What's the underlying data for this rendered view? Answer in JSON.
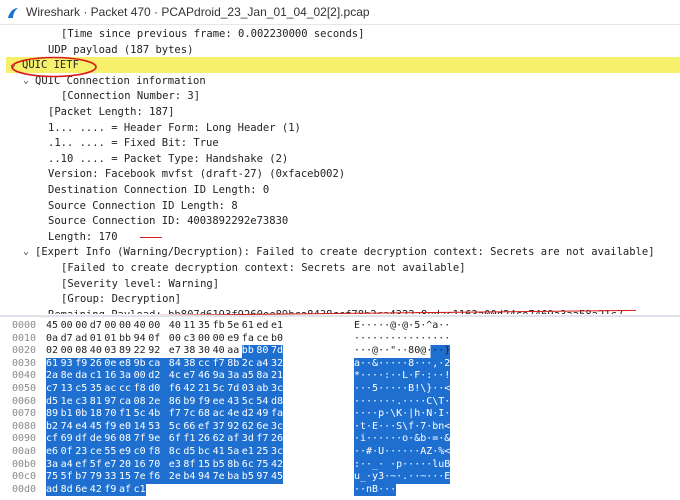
{
  "window": {
    "title": "Wireshark · Packet 470 · PCAPdroid_23_Jan_01_04_02[2].pcap"
  },
  "tree": [
    {
      "indent": 3,
      "chev": "",
      "text": "[Time since previous frame: 0.002230000 seconds]"
    },
    {
      "indent": 2,
      "chev": "",
      "text": "UDP payload (187 bytes)"
    },
    {
      "indent": 0,
      "chev": "v",
      "text": "QUIC IETF",
      "highlight": true
    },
    {
      "indent": 1,
      "chev": "v",
      "text": "QUIC Connection information"
    },
    {
      "indent": 3,
      "chev": "",
      "text": "[Connection Number: 3]"
    },
    {
      "indent": 2,
      "chev": "",
      "text": "[Packet Length: 187]"
    },
    {
      "indent": 2,
      "chev": "",
      "text": "1... .... = Header Form: Long Header (1)"
    },
    {
      "indent": 2,
      "chev": "",
      "text": ".1.. .... = Fixed Bit: True"
    },
    {
      "indent": 2,
      "chev": "",
      "text": "..10 .... = Packet Type: Handshake (2)"
    },
    {
      "indent": 2,
      "chev": "",
      "text": "Version: Facebook mvfst (draft-27) (0xfaceb002)"
    },
    {
      "indent": 2,
      "chev": "",
      "text": "Destination Connection ID Length: 0"
    },
    {
      "indent": 2,
      "chev": "",
      "text": "Source Connection ID Length: 8"
    },
    {
      "indent": 2,
      "chev": "",
      "text": "Source Connection ID: 4003892292e73830"
    },
    {
      "indent": 2,
      "chev": "",
      "text": "Length: 170"
    },
    {
      "indent": 1,
      "chev": "v",
      "text": "[Expert Info (Warning/Decryption): Failed to create decryption context: Secrets are not available]"
    },
    {
      "indent": 3,
      "chev": "",
      "text": "[Failed to create decryption context: Secrets are not available]"
    },
    {
      "indent": 3,
      "chev": "",
      "text": "[Severity level: Warning]"
    },
    {
      "indent": 3,
      "chev": "",
      "text": "[Group: Decryption]"
    },
    {
      "indent": 2,
      "chev": "",
      "text": "Remaining Payload: bb807d6193f9260ee89bca8438ccf78b2ca4322a8edac1163a00d24ce7469a3aa58a21c7…"
    }
  ],
  "hex_rows": [
    {
      "offset": "0000",
      "bytes": [
        "45",
        "00",
        "00",
        "d7",
        "00",
        "00",
        "40",
        "00",
        "40",
        "11",
        "35",
        "fb",
        "5e",
        "61",
        "ed",
        "e1"
      ],
      "ascii": "E·····@·@·5·^a··",
      "sel_from": 99
    },
    {
      "offset": "0010",
      "bytes": [
        "0a",
        "d7",
        "ad",
        "01",
        "01",
        "bb",
        "94",
        "0f",
        "00",
        "c3",
        "00",
        "00",
        "e9",
        "fa",
        "ce",
        "b0"
      ],
      "ascii": "················",
      "sel_from": 99
    },
    {
      "offset": "0020",
      "bytes": [
        "02",
        "00",
        "08",
        "40",
        "03",
        "89",
        "22",
        "92",
        "e7",
        "38",
        "30",
        "40",
        "aa",
        "bb",
        "80",
        "7d"
      ],
      "ascii": "···@··\"··80@···}",
      "sel_from": 13
    },
    {
      "offset": "0030",
      "bytes": [
        "61",
        "93",
        "f9",
        "26",
        "0e",
        "e8",
        "9b",
        "ca",
        "84",
        "38",
        "cc",
        "f7",
        "8b",
        "2c",
        "a4",
        "32"
      ],
      "ascii": "a··&·····8···,·2",
      "sel_from": 0
    },
    {
      "offset": "0040",
      "bytes": [
        "2a",
        "8e",
        "da",
        "c1",
        "16",
        "3a",
        "00",
        "d2",
        "4c",
        "e7",
        "46",
        "9a",
        "3a",
        "a5",
        "8a",
        "21"
      ],
      "ascii": "*····:··L·F·:··!",
      "sel_from": 0
    },
    {
      "offset": "0050",
      "bytes": [
        "c7",
        "13",
        "c5",
        "35",
        "ac",
        "cc",
        "f8",
        "d0",
        "f6",
        "42",
        "21",
        "5c",
        "7d",
        "03",
        "ab",
        "3c"
      ],
      "ascii": "···5·····B!\\}··<",
      "sel_from": 0
    },
    {
      "offset": "0060",
      "bytes": [
        "d5",
        "1e",
        "c3",
        "81",
        "97",
        "ca",
        "08",
        "2e",
        "86",
        "b9",
        "f9",
        "ee",
        "43",
        "5c",
        "54",
        "d8"
      ],
      "ascii": "·······.····C\\T·",
      "sel_from": 0
    },
    {
      "offset": "0070",
      "bytes": [
        "89",
        "b1",
        "0b",
        "18",
        "70",
        "f1",
        "5c",
        "4b",
        "f7",
        "7c",
        "68",
        "ac",
        "4e",
        "d2",
        "49",
        "fa"
      ],
      "ascii": "····p·\\K·|h·N·I·",
      "sel_from": 0
    },
    {
      "offset": "0080",
      "bytes": [
        "b2",
        "74",
        "e4",
        "45",
        "f9",
        "e0",
        "14",
        "53",
        "5c",
        "66",
        "ef",
        "37",
        "92",
        "62",
        "6e",
        "3c"
      ],
      "ascii": "·t·E···S\\f·7·bn<",
      "sel_from": 0
    },
    {
      "offset": "0090",
      "bytes": [
        "cf",
        "69",
        "df",
        "de",
        "96",
        "08",
        "7f",
        "9e",
        "6f",
        "f1",
        "26",
        "62",
        "af",
        "3d",
        "f7",
        "26"
      ],
      "ascii": "·i······o·&b·=·&",
      "sel_from": 0
    },
    {
      "offset": "00a0",
      "bytes": [
        "e6",
        "0f",
        "23",
        "ce",
        "55",
        "e9",
        "c0",
        "f8",
        "8c",
        "d5",
        "bc",
        "41",
        "5a",
        "e1",
        "25",
        "3c"
      ],
      "ascii": "··#·U······AZ·%<",
      "sel_from": 0
    },
    {
      "offset": "00b0",
      "bytes": [
        "3a",
        "a4",
        "ef",
        "5f",
        "e7",
        "20",
        "16",
        "70",
        "e3",
        "8f",
        "15",
        "b5",
        "8b",
        "6c",
        "75",
        "42"
      ],
      "ascii": ":··_· ·p·····luB",
      "sel_from": 0
    },
    {
      "offset": "00c0",
      "bytes": [
        "75",
        "5f",
        "b7",
        "79",
        "33",
        "15",
        "7e",
        "f6",
        "2e",
        "b4",
        "94",
        "7e",
        "ba",
        "b5",
        "97",
        "45"
      ],
      "ascii": "u_·y3·~·.··~···E",
      "sel_from": 0
    },
    {
      "offset": "00d0",
      "bytes": [
        "ad",
        "8d",
        "6e",
        "42",
        "f9",
        "af",
        "c1"
      ],
      "ascii": "··nB···",
      "sel_from": 0
    }
  ]
}
